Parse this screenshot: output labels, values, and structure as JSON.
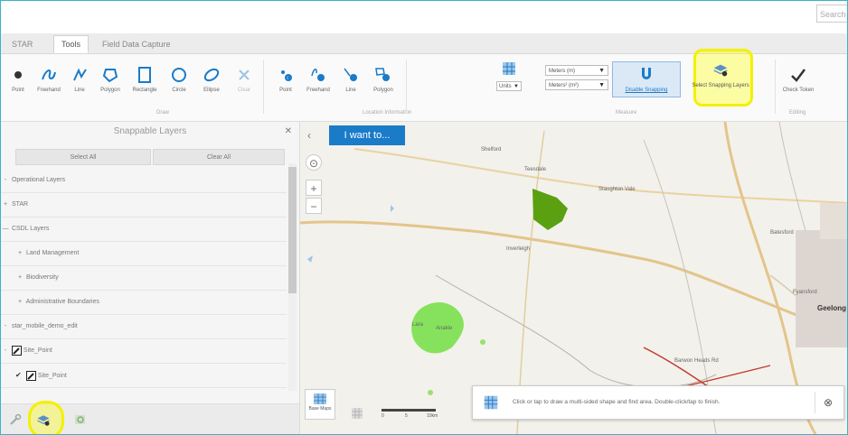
{
  "search": {
    "placeholder": "Search"
  },
  "tabs": [
    {
      "label": "STAR"
    },
    {
      "label": "Tools"
    },
    {
      "label": "Field Data Capture"
    }
  ],
  "ribbon": {
    "draw_tools": [
      {
        "label": "Point",
        "icon": "point-icon"
      },
      {
        "label": "Freehand",
        "icon": "freehand-icon"
      },
      {
        "label": "Line",
        "icon": "line-icon"
      },
      {
        "label": "Polygon",
        "icon": "polygon-icon"
      },
      {
        "label": "Rectangle",
        "icon": "rectangle-icon"
      },
      {
        "label": "Circle",
        "icon": "circle-icon"
      },
      {
        "label": "Ellipse",
        "icon": "ellipse-icon"
      },
      {
        "label": "Clear",
        "icon": "clear-icon"
      }
    ],
    "draw_group": "Draw",
    "location_tools": [
      {
        "label": "Point",
        "icon": "location-point-icon"
      },
      {
        "label": "Freehand",
        "icon": "location-freehand-icon"
      },
      {
        "label": "Line",
        "icon": "location-line-icon"
      },
      {
        "label": "Polygon",
        "icon": "location-polygon-icon"
      }
    ],
    "location_group": "Location Information",
    "measure": {
      "units_label": "Units",
      "length_unit": "Meters (m)",
      "area_unit": "Meters² (m²)",
      "disable_snapping": "Disable Snapping",
      "select_snapping_layers": "Select Snapping Layers",
      "group": "Measure"
    },
    "editing": {
      "check_token": "Check Token",
      "group": "Editing"
    }
  },
  "panel": {
    "title": "Snappable Layers",
    "select_all": "Select All",
    "clear_all": "Clear All",
    "rows": [
      {
        "sign": "-",
        "label": "Operational Layers"
      },
      {
        "sign": "+",
        "label": "STAR"
      },
      {
        "sign": "—",
        "label": "CSDL Layers"
      },
      {
        "sign": "+",
        "label": "Land Management"
      },
      {
        "sign": "+",
        "label": "Biodiversity"
      },
      {
        "sign": "+",
        "label": "Administrative Boundaries"
      },
      {
        "sign": "-",
        "label": "star_mobile_demo_edit"
      },
      {
        "sign": "",
        "label": "Site_Point"
      },
      {
        "sign": "",
        "label": "Site_Point"
      }
    ]
  },
  "map": {
    "i_want_to": "I want to...",
    "basemap_label": "Base Maps",
    "scale_labels": [
      "0",
      "5",
      "10km"
    ],
    "toast": "Click or tap to draw a multi-sided shape and find area. Double-click/tap to finish.",
    "places": [
      "Shelford",
      "Teesdale",
      "Inverleigh",
      "Batesford",
      "Geelong",
      "Lara",
      "Anakie",
      "Staughton Vale",
      "Fyansford",
      "Barwon Heads Rd"
    ]
  },
  "colors": {
    "accent": "#1a7bc9",
    "highlight": "#f3f000",
    "frame": "#3cb3c6",
    "green_area": "#5aa011",
    "light_green_area": "#86e25c"
  }
}
